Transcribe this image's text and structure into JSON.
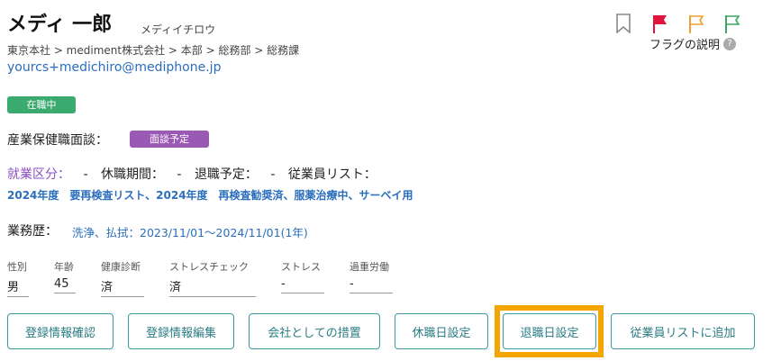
{
  "employee": {
    "name": "メディ 一郎",
    "kana": "メディイチロウ",
    "breadcrumb": "東京本社 > mediment株式会社 > 本部 > 総務部 > 総務課",
    "email": "yourcs+medichiro@mediphone.jp",
    "status_badge": "在職中"
  },
  "flags": {
    "bookmark_icon": "bookmark-icon",
    "red_flag_color": "#e0143c",
    "orange_flag_color": "#f0a030",
    "green_flag_color": "#3aa860",
    "help_label": "フラグの説明",
    "help_icon": "?"
  },
  "interview": {
    "label": "産業保健職面談：",
    "badge": "面談予定"
  },
  "status_row": {
    "work_class_label": "就業区分：",
    "work_class_value": "-",
    "leave_period_label": "休職期間：",
    "leave_period_value": "-",
    "retirement_label": "退職予定：",
    "retirement_value": "-",
    "employee_list_label": "従業員リスト："
  },
  "employee_lists": "2024年度　要再検査リスト、2024年度　再検査勧奨済、服薬治療中、サーベイ用",
  "work_history": {
    "label": "業務歴：",
    "value": "洗浄、払拭：2023/11/01～2024/11/01(1年)"
  },
  "stats": [
    {
      "label": "性別",
      "value": "男"
    },
    {
      "label": "年齢",
      "value": "45"
    },
    {
      "label": "健康診断",
      "value": "済"
    },
    {
      "label": "ストレスチェック",
      "value": "済"
    },
    {
      "label": "ストレス",
      "value": "-"
    },
    {
      "label": "過重労働",
      "value": "-"
    }
  ],
  "buttons": {
    "register_confirm": "登録情報確認",
    "register_edit": "登録情報編集",
    "company_measures": "会社としての措置",
    "leave_setting": "休職日設定",
    "retirement_setting": "退職日設定",
    "add_to_list": "従業員リストに追加"
  }
}
